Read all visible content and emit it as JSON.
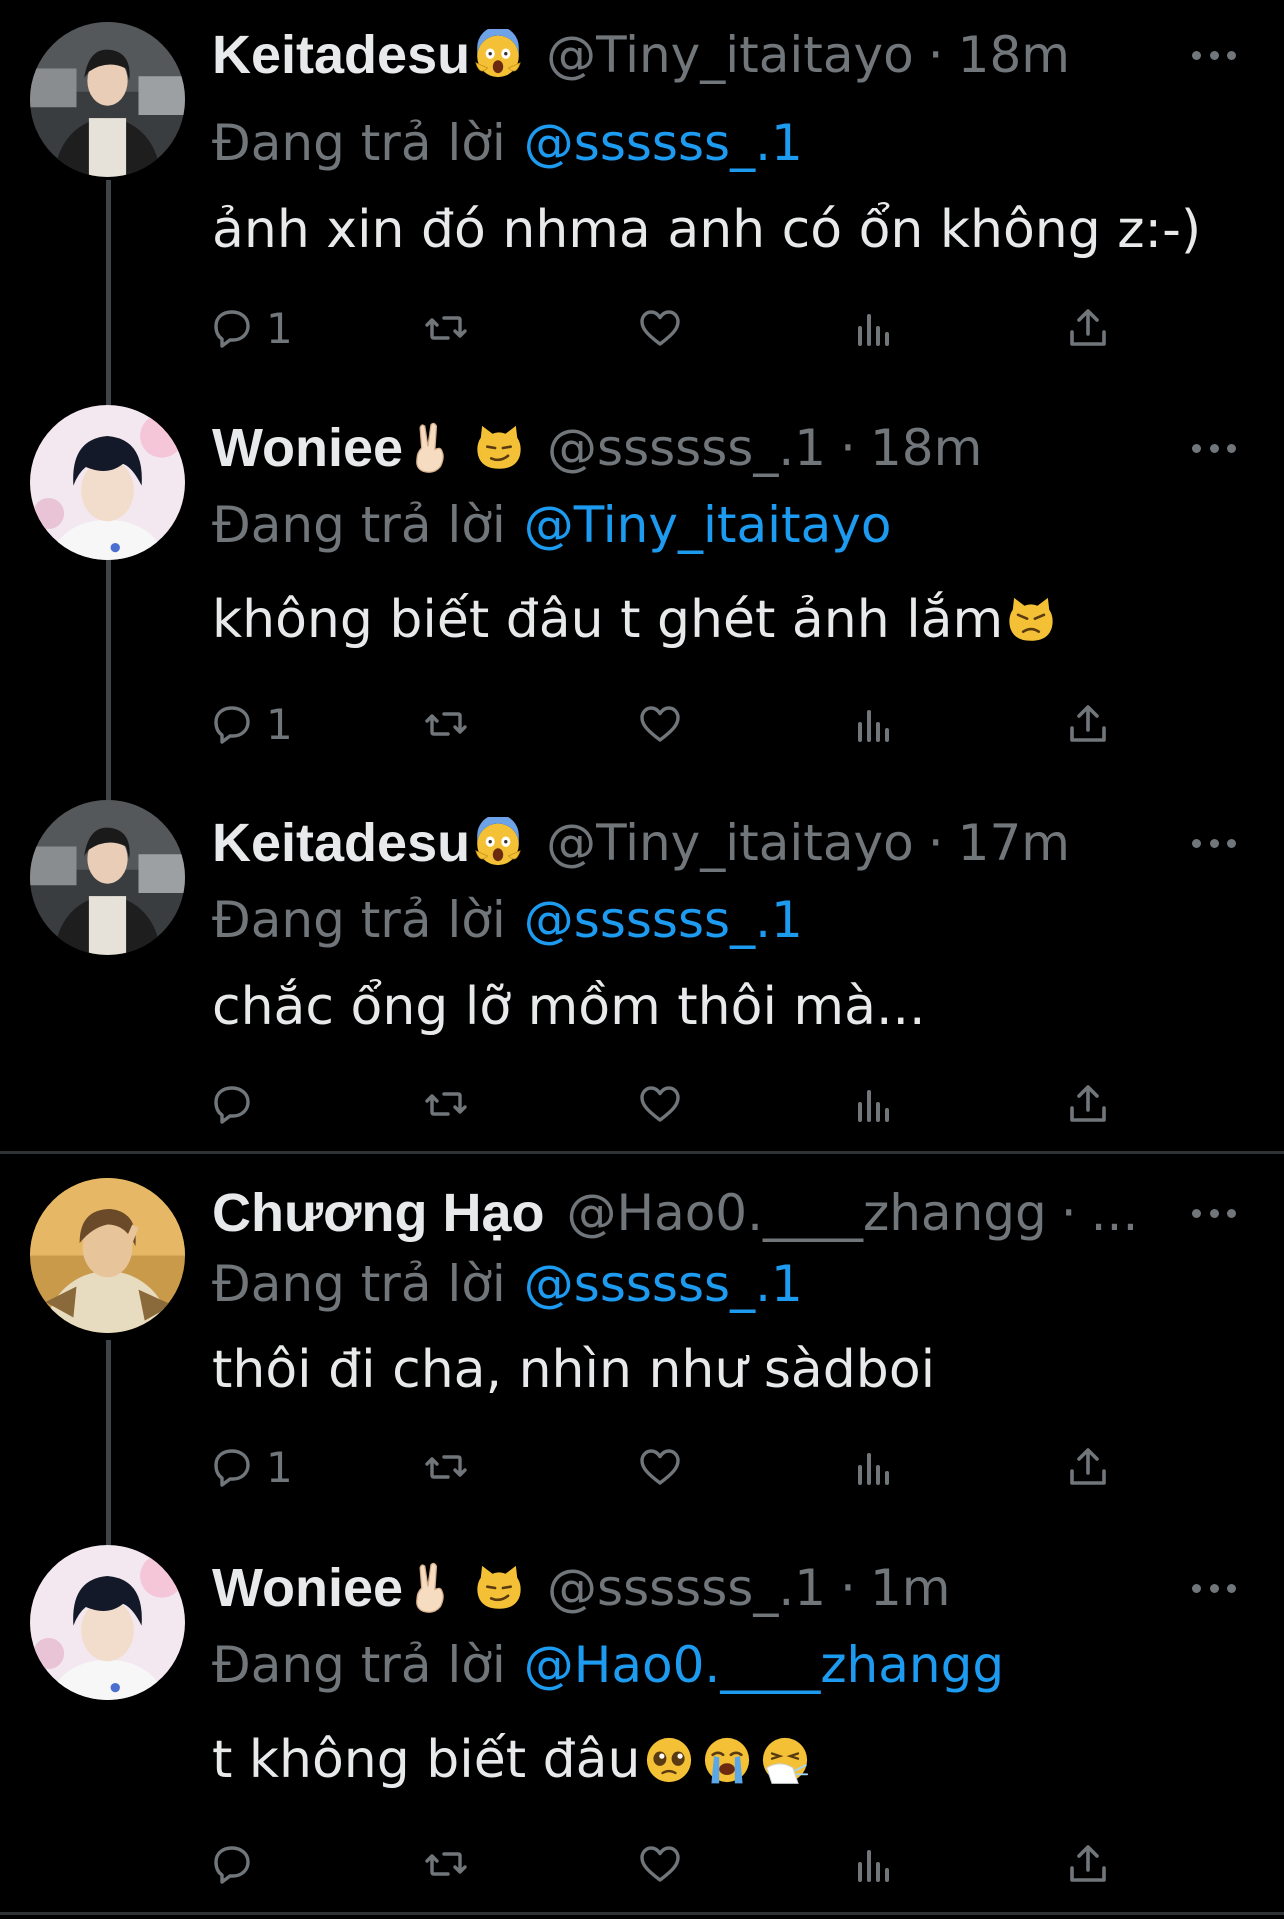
{
  "colors": {
    "background": "#000000",
    "text": "#e7e9ea",
    "muted": "#71767b",
    "link": "#1d9bf0",
    "divider": "#2f3336"
  },
  "icons": {
    "reply": "speech-bubble-icon",
    "retweet": "retweet-icon",
    "like": "heart-icon",
    "views": "bar-chart-icon",
    "share": "share-upload-icon",
    "more": "ellipsis-icon"
  },
  "reply_prefix": "Đang trả lời",
  "tweets": [
    {
      "name": "Keitadesu",
      "name_emojis": [
        "face-screaming-in-fear-emoji"
      ],
      "handle": "@Tiny_itaitayo",
      "separator": "·",
      "time": "18m",
      "reply_to": "@ssssss_.1",
      "text": "ảnh xin đó nhma anh có ổn không z:-)",
      "text_emojis": [],
      "reply_count": "1",
      "avatar": "keita-avatar"
    },
    {
      "name": "Woniee",
      "name_emojis": [
        "victory-hand-emoji",
        "smirking-cat-emoji"
      ],
      "handle": "@ssssss_.1",
      "separator": "·",
      "time": "18m",
      "reply_to": "@Tiny_itaitayo",
      "text": "không biết đâu t ghét ảnh lắm",
      "text_emojis": [
        "pouting-cat-emoji"
      ],
      "reply_count": "1",
      "avatar": "woniee-avatar"
    },
    {
      "name": "Keitadesu",
      "name_emojis": [
        "face-screaming-in-fear-emoji"
      ],
      "handle": "@Tiny_itaitayo",
      "separator": "·",
      "time": "17m",
      "reply_to": "@ssssss_.1",
      "text": "chắc ổng lỡ mồm thôi mà...",
      "text_emojis": [],
      "reply_count": "",
      "avatar": "keita-avatar"
    },
    {
      "name": "Chương Hạo",
      "name_emojis": [],
      "handle": "@Hao0.____zhangg",
      "separator": "·",
      "time": "...",
      "reply_to": "@ssssss_.1",
      "text": "thôi đi cha, nhìn như sàdboi",
      "text_emojis": [],
      "reply_count": "1",
      "avatar": "hao-avatar"
    },
    {
      "name": "Woniee",
      "name_emojis": [
        "victory-hand-emoji",
        "smirking-cat-emoji"
      ],
      "handle": "@ssssss_.1",
      "separator": "·",
      "time": "1m",
      "reply_to": "@Hao0.____zhangg",
      "text": "t không biết đâu",
      "text_emojis": [
        "pleading-face-emoji",
        "loudly-crying-face-emoji",
        "sneezing-face-emoji"
      ],
      "reply_count": "",
      "avatar": "woniee-avatar"
    }
  ]
}
